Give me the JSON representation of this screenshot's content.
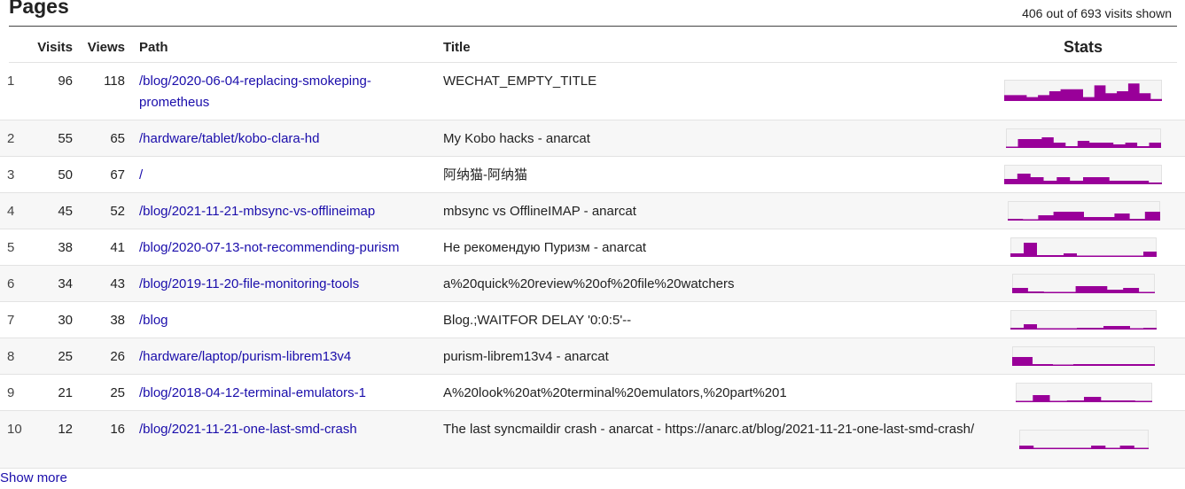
{
  "section": {
    "title": "Pages",
    "visits_shown": "406 out of 693 visits shown"
  },
  "columns": {
    "visits": "Visits",
    "views": "Views",
    "path": "Path",
    "title": "Title",
    "stats": "Stats"
  },
  "rows": [
    {
      "idx": "1",
      "visits": "96",
      "views": "118",
      "path": "/blog/2020-06-04-replacing-smokeping-prometheus",
      "title": "WECHAT_EMPTY_TITLE"
    },
    {
      "idx": "2",
      "visits": "55",
      "views": "65",
      "path": "/hardware/tablet/kobo-clara-hd",
      "title": "My Kobo hacks - anarcat"
    },
    {
      "idx": "3",
      "visits": "50",
      "views": "67",
      "path": "/",
      "title": "阿纳猫-阿纳猫"
    },
    {
      "idx": "4",
      "visits": "45",
      "views": "52",
      "path": "/blog/2021-11-21-mbsync-vs-offlineimap",
      "title": "mbsync vs OfflineIMAP - anarcat"
    },
    {
      "idx": "5",
      "visits": "38",
      "views": "41",
      "path": "/blog/2020-07-13-not-recommending-purism",
      "title": "Не рекомендую Пуризм - anarcat"
    },
    {
      "idx": "6",
      "visits": "34",
      "views": "43",
      "path": "/blog/2019-11-20-file-monitoring-tools",
      "title": "a%20quick%20review%20of%20file%20watchers"
    },
    {
      "idx": "7",
      "visits": "30",
      "views": "38",
      "path": "/blog",
      "title": "Blog.;WAITFOR DELAY '0:0:5'--"
    },
    {
      "idx": "8",
      "visits": "25",
      "views": "26",
      "path": "/hardware/laptop/purism-librem13v4",
      "title": "purism-librem13v4 - anarcat"
    },
    {
      "idx": "9",
      "visits": "21",
      "views": "25",
      "path": "/blog/2018-04-12-terminal-emulators-1",
      "title": "A%20look%20at%20terminal%20emulators,%20part%201"
    },
    {
      "idx": "10",
      "visits": "12",
      "views": "16",
      "path": "/blog/2021-11-21-one-last-smd-crash",
      "title": "The last syncmaildir crash - anarcat - https://anarc.at/blog/2021-11-21-one-last-smd-crash/"
    }
  ],
  "sparklines": [
    [
      0.3,
      0.3,
      0.2,
      0.3,
      0.5,
      0.6,
      0.6,
      0.2,
      0.8,
      0.4,
      0.5,
      0.9,
      0.4,
      0.1
    ],
    [
      0.0,
      0.5,
      0.5,
      0.6,
      0.3,
      0.1,
      0.4,
      0.3,
      0.3,
      0.2,
      0.3,
      0.1,
      0.3
    ],
    [
      0.3,
      0.6,
      0.4,
      0.2,
      0.4,
      0.2,
      0.4,
      0.4,
      0.2,
      0.2,
      0.2,
      0.1
    ],
    [
      0.1,
      0.0,
      0.3,
      0.5,
      0.5,
      0.2,
      0.2,
      0.4,
      0.1,
      0.5
    ],
    [
      0.2,
      0.8,
      0.1,
      0.1,
      0.2,
      0.0,
      0.0,
      0.0,
      0.0,
      0.0,
      0.3
    ],
    [
      0.3,
      0.1,
      0.0,
      0.0,
      0.4,
      0.4,
      0.2,
      0.3,
      0.0
    ],
    [
      0.1,
      0.3,
      0.0,
      0.0,
      0.0,
      0.1,
      0.1,
      0.2,
      0.2,
      0.0,
      0.1
    ],
    [
      0.5,
      0.1,
      0.0,
      0.1,
      0.1,
      0.1,
      0.1
    ],
    [
      0.0,
      0.4,
      0.0,
      0.1,
      0.3,
      0.1,
      0.1,
      0.0
    ],
    [
      0.2,
      0.0,
      0.0,
      0.0,
      0.0,
      0.2,
      0.0,
      0.2,
      0.0
    ]
  ],
  "show_more": "Show more",
  "colors": {
    "link": "#1a0dab",
    "sparkline": "#990099",
    "row_alt": "#f7f7f7"
  }
}
